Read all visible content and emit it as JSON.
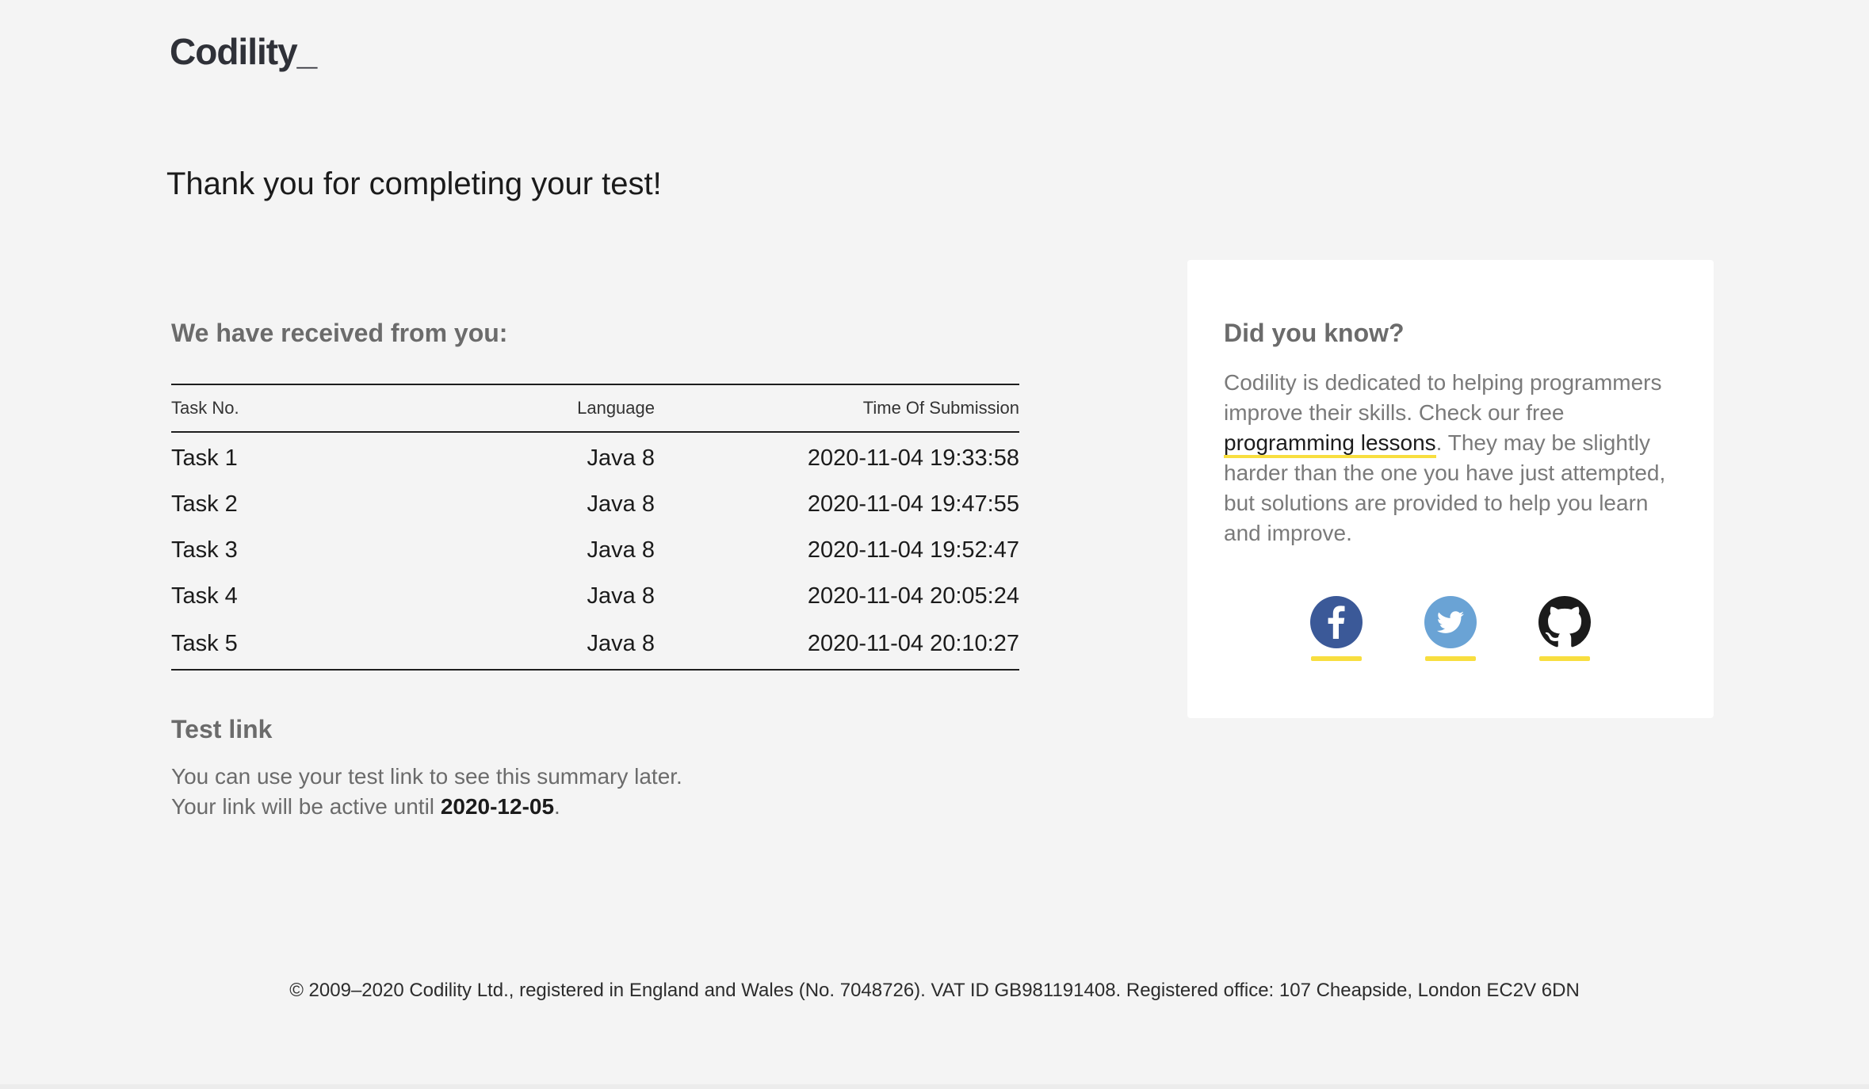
{
  "logo": "Codility_",
  "title": "Thank you for completing your test!",
  "received": {
    "heading": "We have received from you:",
    "columns": [
      "Task No.",
      "Language",
      "Time Of Submission"
    ],
    "rows": [
      {
        "task": "Task 1",
        "language": "Java 8",
        "time": "2020-11-04 19:33:58"
      },
      {
        "task": "Task 2",
        "language": "Java 8",
        "time": "2020-11-04 19:47:55"
      },
      {
        "task": "Task 3",
        "language": "Java 8",
        "time": "2020-11-04 19:52:47"
      },
      {
        "task": "Task 4",
        "language": "Java 8",
        "time": "2020-11-04 20:05:24"
      },
      {
        "task": "Task 5",
        "language": "Java 8",
        "time": "2020-11-04 20:10:27"
      }
    ]
  },
  "test_link": {
    "heading": "Test link",
    "line1": "You can use your test link to see this summary later.",
    "line2_prefix": "Your link will be active until ",
    "date": "2020-12-05",
    "line2_suffix": "."
  },
  "did_you_know": {
    "heading": "Did you know?",
    "text_before": "Codility is dedicated to helping programmers improve their skills. Check our free ",
    "link": "programming lessons",
    "text_after": ". They may be slightly harder than the one you have just attempted, but solutions are provided to help you learn and improve."
  },
  "social_icons": [
    {
      "name": "facebook-icon",
      "color": "#3b5998"
    },
    {
      "name": "twitter-icon",
      "color": "#6aa3d5"
    },
    {
      "name": "github-icon",
      "color": "#1b1b1b"
    }
  ],
  "accent": "#f8de3f",
  "footer": "© 2009–2020 Codility Ltd., registered in England and Wales (No. 7048726). VAT ID GB981191408. Registered office: 107 Cheapside, London EC2V 6DN"
}
